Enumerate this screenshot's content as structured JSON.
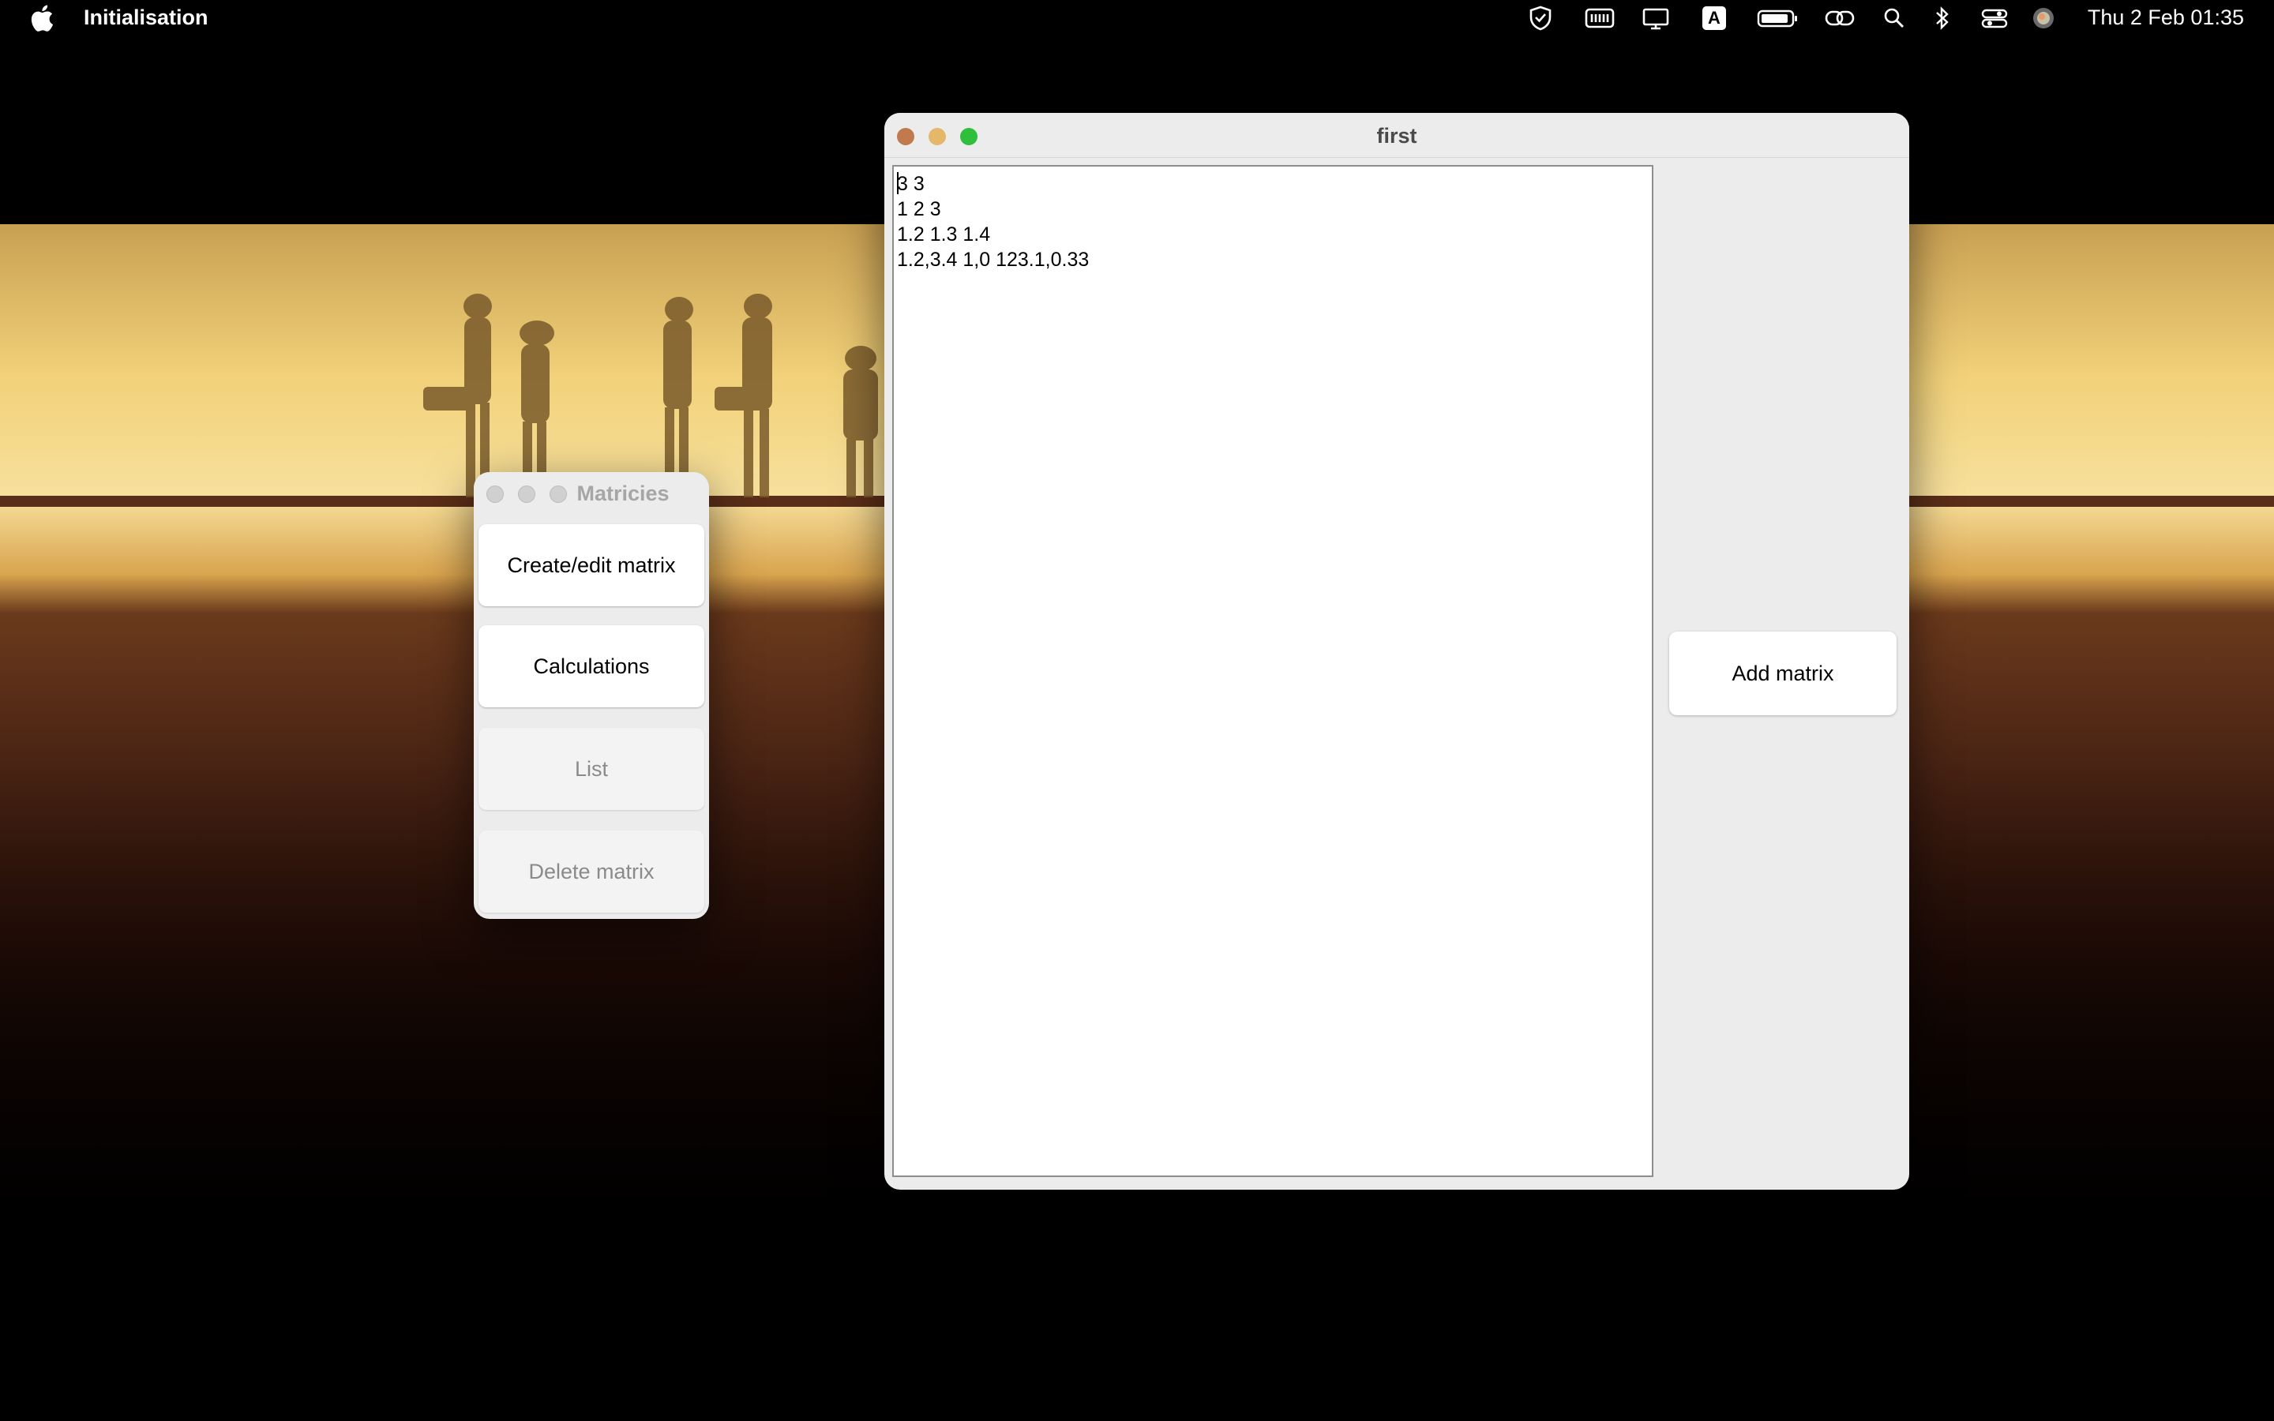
{
  "menubar": {
    "app_name": "Initialisation",
    "clock": "Thu 2 Feb  01:35",
    "status_icons": [
      "shield-check-icon",
      "keyboard-icon",
      "display-icon",
      "input-source-icon",
      "battery-icon",
      "link-icon",
      "search-icon",
      "bluetooth-icon",
      "control-center-icon",
      "siri-icon"
    ],
    "input_source_letter": "A"
  },
  "matricies_window": {
    "title": "Matricies",
    "buttons": {
      "create_edit": "Create/edit matrix",
      "calculations": "Calculations",
      "list": "List",
      "delete": "Delete matrix"
    }
  },
  "first_window": {
    "title": "first",
    "editor_lines": [
      "3 3",
      "1 2 3",
      "1.2 1.3 1.4",
      "1.2,3.4 1,0 123.1,0.33"
    ],
    "add_button": "Add matrix"
  },
  "colors": {
    "close": "#ee6a5e",
    "minimize": "#f5bf4f",
    "zoom": "#61c554"
  }
}
